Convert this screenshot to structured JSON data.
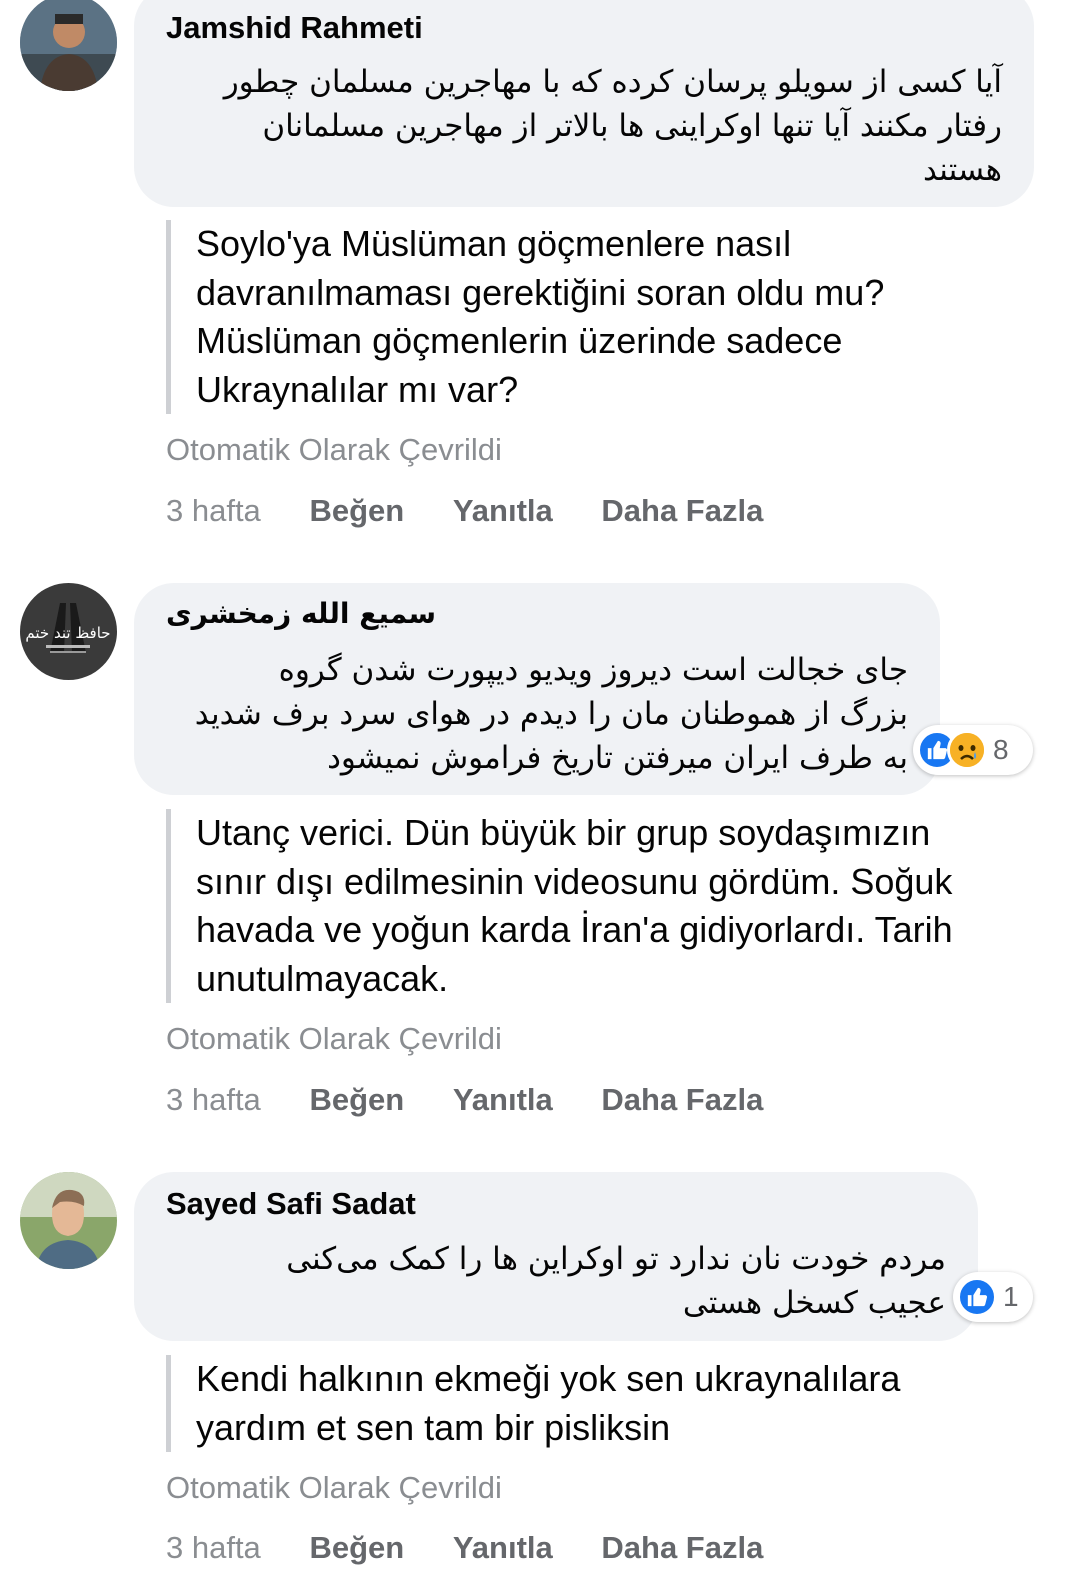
{
  "comments": [
    {
      "author": "Jamshid Rahmeti",
      "original_lines": [
        "آیا کسی از سویلو پرسان کرده که با مهاجرین مسلمان چطور",
        "رفتار مکنند آیا تنها اوکراینی ها بالاتر از مهاجرین مسلمانان",
        "هستند"
      ],
      "translation_lines": [
        "Soylo'ya Müslüman göçmenlere nasıl",
        "davranılmaması gerektiğini soran oldu mu?",
        "Müslüman göçmenlerin üzerinde sadece",
        "Ukraynalılar mı var?"
      ],
      "translated_label": "Otomatik Olarak Çevrildi",
      "time": "3 hafta",
      "like_label": "Beğen",
      "reply_label": "Yanıtla",
      "more_label": "Daha Fazla"
    },
    {
      "author": "سمیع الله زمخشری",
      "original_lines": [
        "جای خجالت است دیروز ویدیو دیپورت شدن گروه",
        "بزرگ از هموطنان مان را دیدم در هوای سرد برف شدید",
        "به طرف ایران میرفتن تاریخ فراموش نمیشود"
      ],
      "reaction_count": "8",
      "reactions": [
        "like-icon",
        "sad-icon"
      ],
      "avatar_text": "حافظ تند ختم",
      "translation_lines": [
        "Utanç verici. Dün büyük bir grup soydaşımızın",
        "sınır dışı edilmesinin videosunu gördüm. Soğuk",
        "havada ve yoğun karda İran'a gidiyorlardı. Tarih",
        "unutulmayacak."
      ],
      "translated_label": "Otomatik Olarak Çevrildi",
      "time": "3 hafta",
      "like_label": "Beğen",
      "reply_label": "Yanıtla",
      "more_label": "Daha Fazla"
    },
    {
      "author": "Sayed Safi Sadat",
      "original_lines": [
        "مردم خودت نان ندارد تو اوکراین ها را کمک می‌کنی",
        "عجیب کسخل هستی"
      ],
      "reaction_count": "1",
      "reactions": [
        "like-icon"
      ],
      "translation_lines": [
        "Kendi halkının ekmeği yok sen ukraynalılara",
        "yardım et sen tam bir pisliksin"
      ],
      "translated_label": "Otomatik Olarak Çevrildi",
      "time": "3 hafta",
      "like_label": "Beğen",
      "reply_label": "Yanıtla",
      "more_label": "Daha Fazla"
    }
  ],
  "colors": {
    "bubble": "#f0f2f5",
    "meta_text": "#8a8d91",
    "action_text": "#65676b",
    "like_blue": "#1877f2",
    "sad_yellow": "#f7b125"
  }
}
